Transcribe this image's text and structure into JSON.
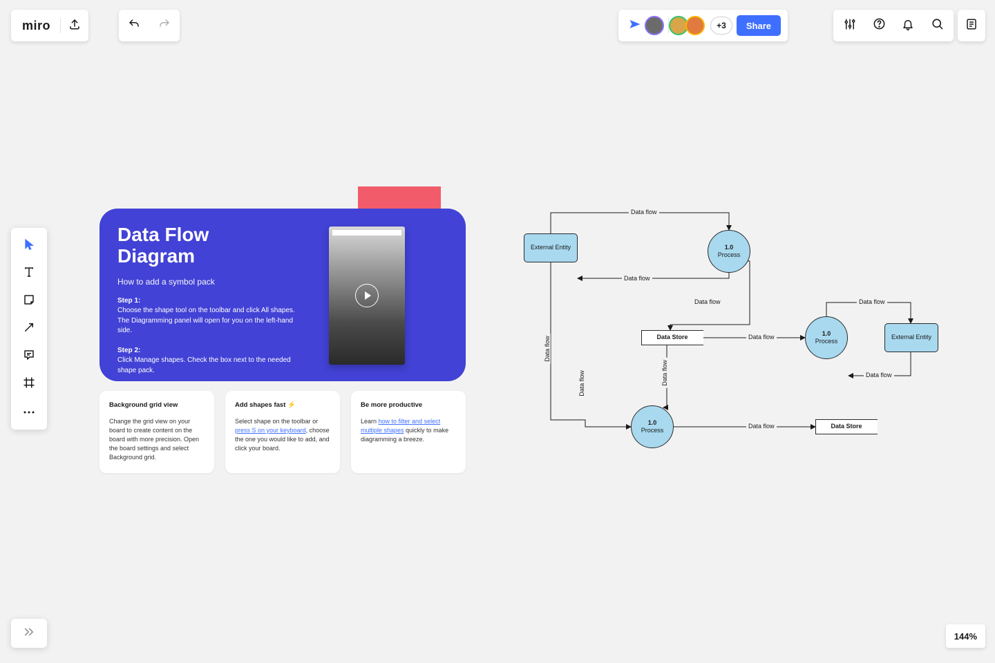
{
  "app": {
    "logo": "miro"
  },
  "header": {
    "plus_count": "+3",
    "share_label": "Share"
  },
  "zoom": {
    "level": "144%"
  },
  "info": {
    "title1": "Data Flow",
    "title2": "Diagram",
    "subtitle": "How to add a symbol pack",
    "step1_label": "Step 1:",
    "step1_body": "Choose the shape tool on the toolbar and click All shapes. The Diagramming panel will open for you on the left-hand side.",
    "step2_label": "Step 2:",
    "step2_body": "Click Manage shapes. Check the box next to the needed shape pack."
  },
  "tips": [
    {
      "title": "Background grid view",
      "body": "Change the grid view on your board to create content on the board with more precision. Open the board settings and select Background grid."
    },
    {
      "title": "Add shapes fast ⚡",
      "body_pre": "Select shape on the toolbar or ",
      "link": "press S on your keyboard",
      "body_post": ", choose the one you would like to add, and click your board."
    },
    {
      "title": "Be more productive",
      "body_pre": "Learn ",
      "link": "how to filter and select multiple shapes",
      "body_post": " quickly to make diagramming a breeze."
    }
  ],
  "diagram": {
    "entities": [
      {
        "label": "External Entity"
      },
      {
        "label": "External Entity"
      }
    ],
    "processes": [
      {
        "line1": "1.0",
        "line2": "Process"
      },
      {
        "line1": "1.0",
        "line2": "Process"
      },
      {
        "line1": "1.0",
        "line2": "Process"
      }
    ],
    "stores": [
      {
        "label": "Data Store"
      },
      {
        "label": "Data Store"
      }
    ],
    "edge_label": "Data flow"
  },
  "chart_data": {
    "type": "data-flow-diagram",
    "nodes": [
      {
        "id": "E1",
        "kind": "external_entity",
        "label": "External Entity"
      },
      {
        "id": "P1",
        "kind": "process",
        "label": "1.0 Process"
      },
      {
        "id": "P2",
        "kind": "process",
        "label": "1.0 Process"
      },
      {
        "id": "P3",
        "kind": "process",
        "label": "1.0 Process"
      },
      {
        "id": "D1",
        "kind": "data_store",
        "label": "Data Store"
      },
      {
        "id": "E2",
        "kind": "external_entity",
        "label": "External Entity"
      },
      {
        "id": "D2",
        "kind": "data_store",
        "label": "Data Store"
      }
    ],
    "edges": [
      {
        "from": "E1",
        "to": "P1",
        "label": "Data flow"
      },
      {
        "from": "P1",
        "to": "E1",
        "label": "Data flow"
      },
      {
        "from": "P1",
        "to": "D1",
        "label": "Data flow"
      },
      {
        "from": "D1",
        "to": "P2",
        "label": "Data flow"
      },
      {
        "from": "P2",
        "to": "E2",
        "label": "Data flow"
      },
      {
        "from": "E2",
        "to": "P2",
        "label": "Data flow"
      },
      {
        "from": "E1",
        "to": "P3",
        "label": "Data flow"
      },
      {
        "from": "D1",
        "to": "P3",
        "label": "Data flow"
      },
      {
        "from": "P3",
        "to": "D2",
        "label": "Data flow"
      }
    ]
  }
}
